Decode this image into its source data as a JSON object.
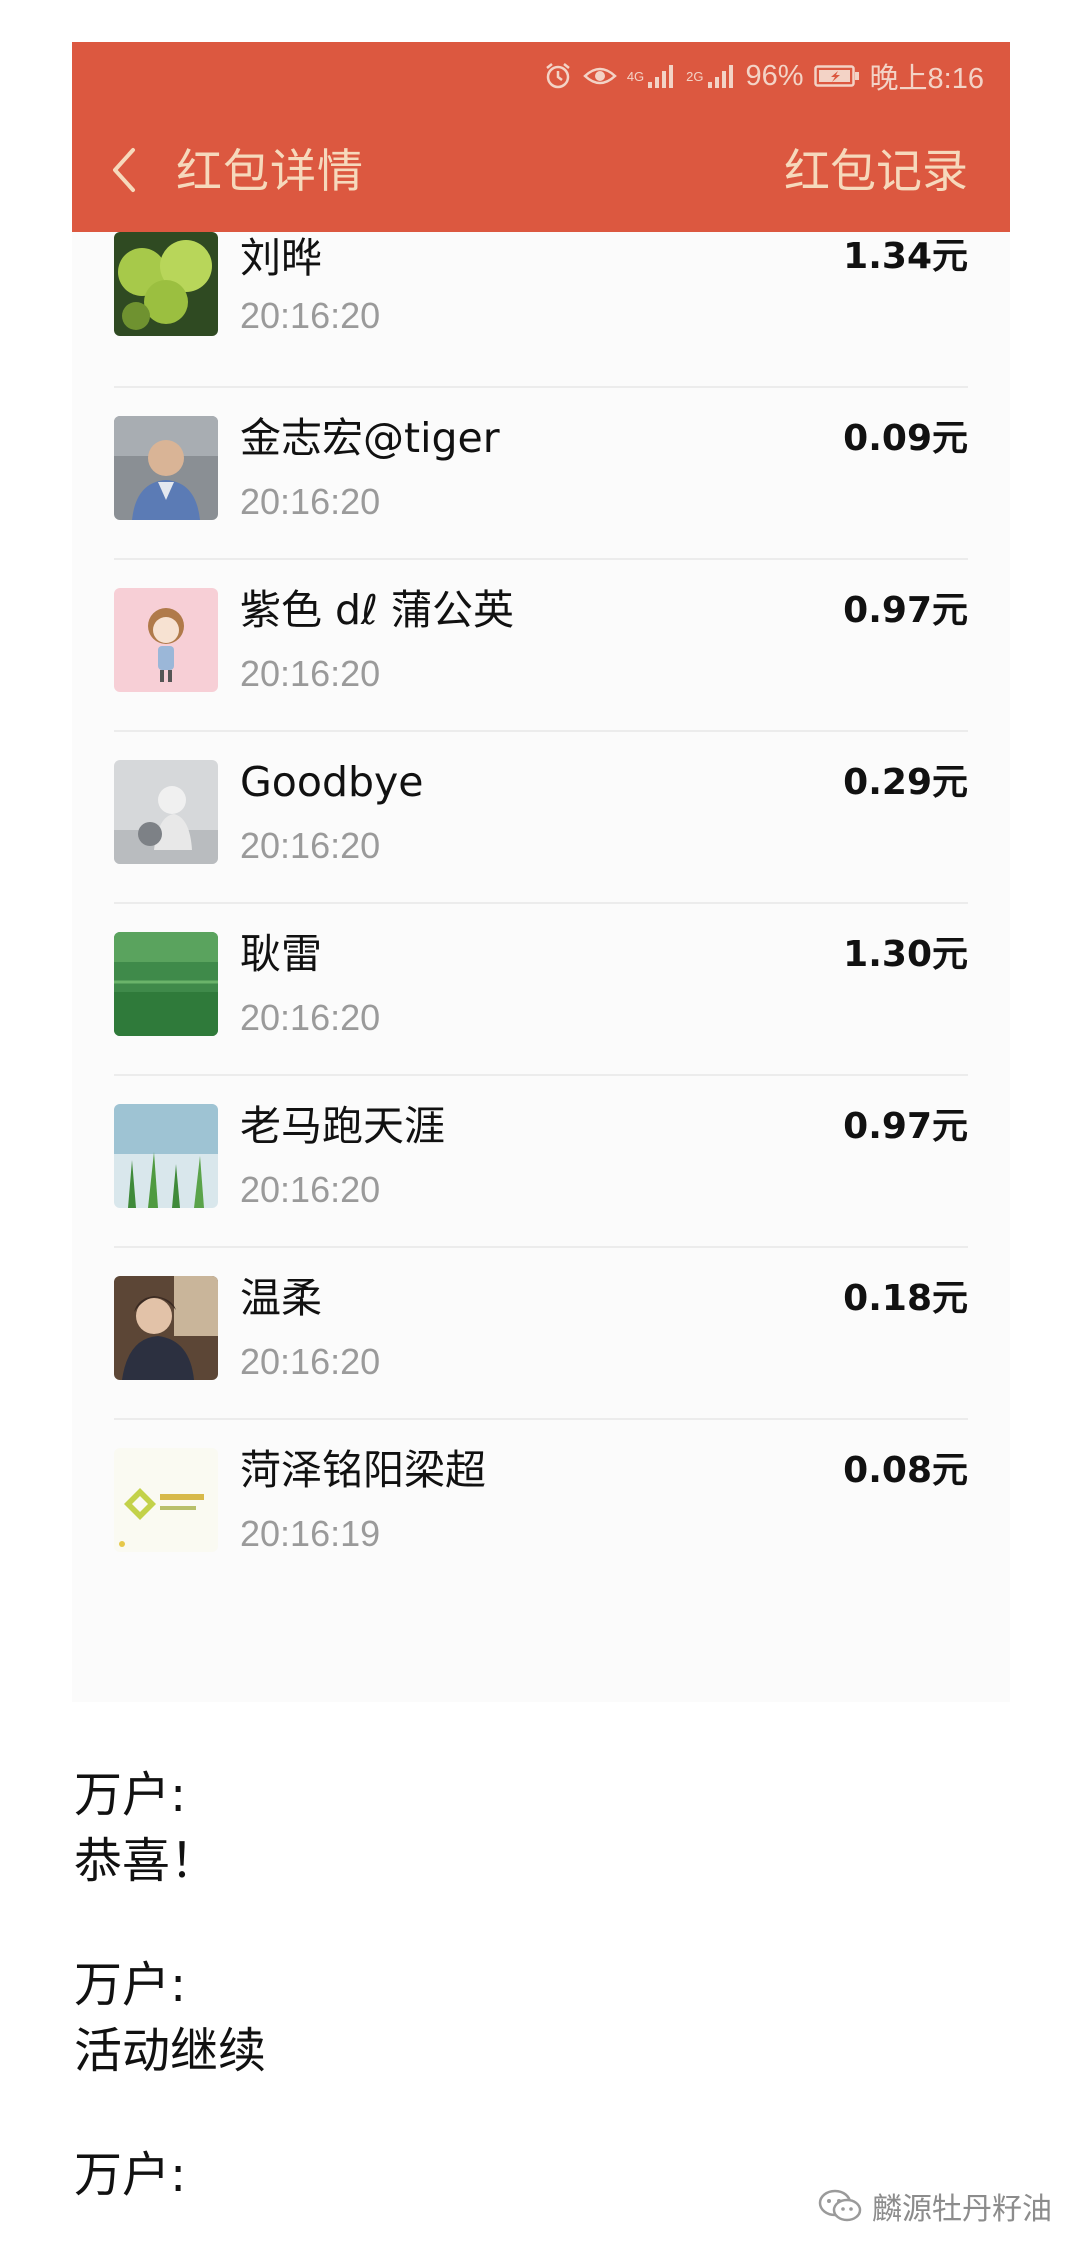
{
  "status_bar": {
    "icons": [
      "alarm-icon",
      "eye-icon",
      "4g-signal-icon",
      "2g-signal-icon",
      "battery-icon"
    ],
    "network_4g": "4G",
    "network_2g": "2G",
    "battery": "96%",
    "time": "晚上8:16"
  },
  "header": {
    "back_icon": "chevron-left-icon",
    "title": "红包详情",
    "right_action": "红包记录",
    "color": "#dc5840"
  },
  "records": [
    {
      "name": "刘晔",
      "time": "20:16:20",
      "amount": "1.34元"
    },
    {
      "name": "金志宏@tiger",
      "time": "20:16:20",
      "amount": "0.09元"
    },
    {
      "name": "紫色 dℓ 蒲公英",
      "time": "20:16:20",
      "amount": "0.97元"
    },
    {
      "name": "Goodbye",
      "time": "20:16:20",
      "amount": "0.29元"
    },
    {
      "name": "耿雷",
      "time": "20:16:20",
      "amount": "1.30元"
    },
    {
      "name": "老马跑天涯",
      "time": "20:16:20",
      "amount": "0.97元"
    },
    {
      "name": "温柔",
      "time": "20:16:20",
      "amount": "0.18元"
    },
    {
      "name": "菏泽铭阳梁超",
      "time": "20:16:19",
      "amount": "0.08元"
    }
  ],
  "comments": [
    {
      "author": "万户:",
      "text": "恭喜！"
    },
    {
      "author": "万户:",
      "text": "活动继续"
    },
    {
      "author": "万户:",
      "text": ""
    }
  ],
  "watermark": {
    "icon": "wechat-icon",
    "text": "麟源牡丹籽油"
  }
}
